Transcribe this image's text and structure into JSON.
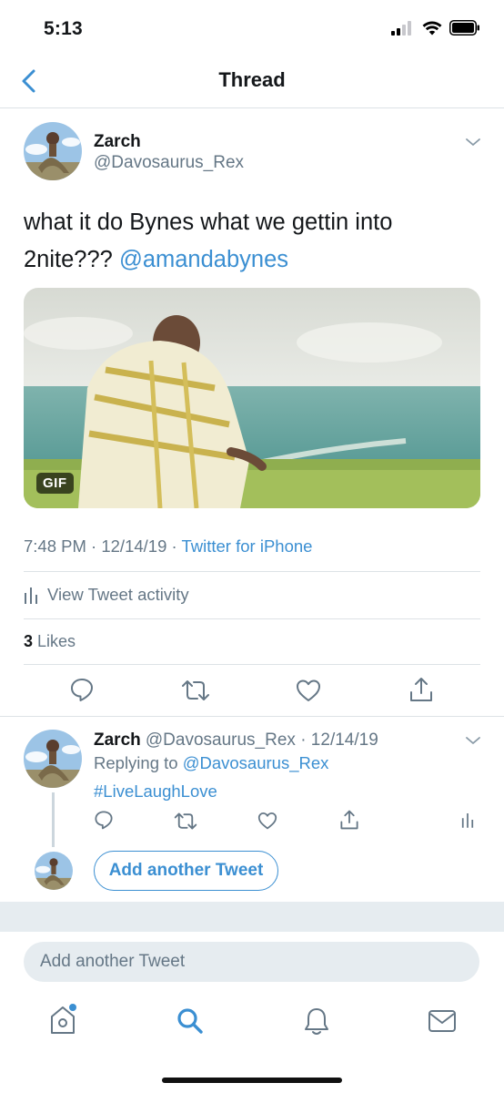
{
  "status_bar": {
    "time": "5:13"
  },
  "nav": {
    "title": "Thread"
  },
  "tweet": {
    "author_name": "Zarch",
    "author_handle": "@Davosaurus_Rex",
    "text_plain": "what it do Bynes what we gettin into 2nite??? ",
    "text_mention": "@amandabynes",
    "media_badge": "GIF",
    "time": "7:48 PM",
    "date": "12/14/19",
    "separator": " · ",
    "source": "Twitter for iPhone",
    "activity_label": "View Tweet activity",
    "likes_count": "3",
    "likes_label": " Likes"
  },
  "reply": {
    "author_name": "Zarch",
    "author_handle": "@Davosaurus_Rex",
    "date_suffix": " · 12/14/19",
    "replying_prefix": "Replying to ",
    "replying_handle": "@Davosaurus_Rex",
    "hashtag": "#LiveLaughLove"
  },
  "thread_actions": {
    "add_another_tweet": "Add another Tweet"
  },
  "composer": {
    "placeholder": "Add another Tweet"
  },
  "colors": {
    "accent": "#3b8fd2",
    "secondary_text": "#657786",
    "divider": "#dde2e6"
  },
  "tab_bar": {
    "icons": [
      "home-icon",
      "search-icon",
      "notifications-icon",
      "messages-icon"
    ]
  }
}
